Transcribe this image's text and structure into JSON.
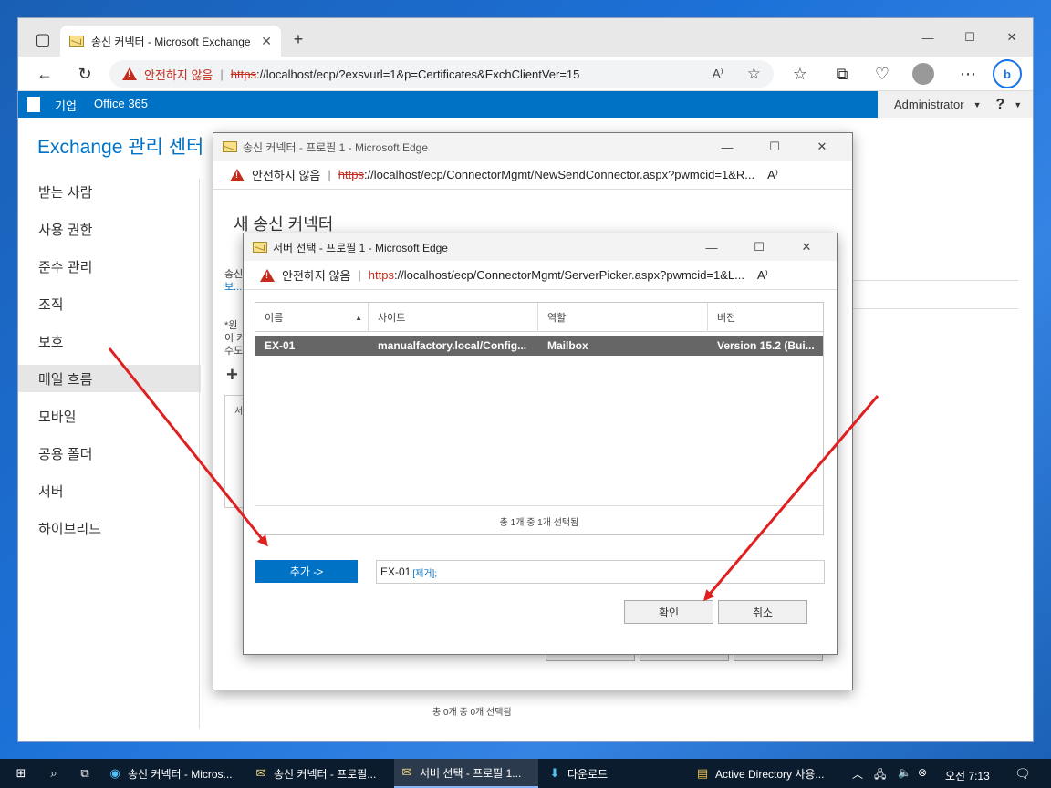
{
  "browser": {
    "tab_title": "송신 커넥터 - Microsoft Exchange",
    "url_warning": "안전하지 않음",
    "url_scheme": "https",
    "url_rest": "://localhost/ecp/?exsvurl=1&p=Certificates&ExchClientVer=15"
  },
  "o365": {
    "enterprise": "기업",
    "office365": "Office 365",
    "user": "Administrator",
    "help": "?"
  },
  "eac": {
    "title": "Exchange 관리 센터",
    "sidebar": [
      "받는 사람",
      "사용 권한",
      "준수 관리",
      "조직",
      "보호",
      "메일 흐름",
      "모바일",
      "공용 폴더",
      "서버",
      "하이브리드"
    ],
    "active_index": 5,
    "footer_status": "총 0개 중 0개 선택됨"
  },
  "dialog1": {
    "title": "송신 커넥터 - 프로필 1 - Microsoft Edge",
    "url_warning": "안전하지 않음",
    "url_scheme": "https",
    "url_rest": "://localhost/ecp/ConnectorMgmt/NewSendConnector.aspx?pwmcid=1&R...",
    "heading": "새 송신 커넥터",
    "frag1": "송신",
    "frag2": "보...",
    "frag3": "*원",
    "frag4": "이 커",
    "frag5": "수도",
    "plus": "+",
    "col_frag": "서"
  },
  "dialog2": {
    "title": "서버 선택 - 프로필 1 - Microsoft Edge",
    "url_warning": "안전하지 않음",
    "url_scheme": "https",
    "url_rest": "://localhost/ecp/ConnectorMgmt/ServerPicker.aspx?pwmcid=1&L...",
    "columns": [
      "이름",
      "사이트",
      "역할",
      "버전"
    ],
    "row": {
      "name": "EX-01",
      "site": "manualfactory.local/Config...",
      "role": "Mailbox",
      "version": "Version 15.2 (Bui..."
    },
    "status": "총 1개 중 1개 선택됨",
    "add_button": "추가 ->",
    "selected_value": "EX-01",
    "remove_link": "[제거];",
    "ok_button": "확인",
    "cancel_button": "취소"
  },
  "taskbar": {
    "items": [
      "송신 커넥터 - Micros...",
      "송신 커넥터 - 프로필...",
      "서버 선택 - 프로필 1...",
      "다운로드",
      "Active Directory 사용..."
    ],
    "clock": "오전 7:13"
  },
  "colors": {
    "accent": "#0072c6",
    "arrow": "#e02020"
  }
}
